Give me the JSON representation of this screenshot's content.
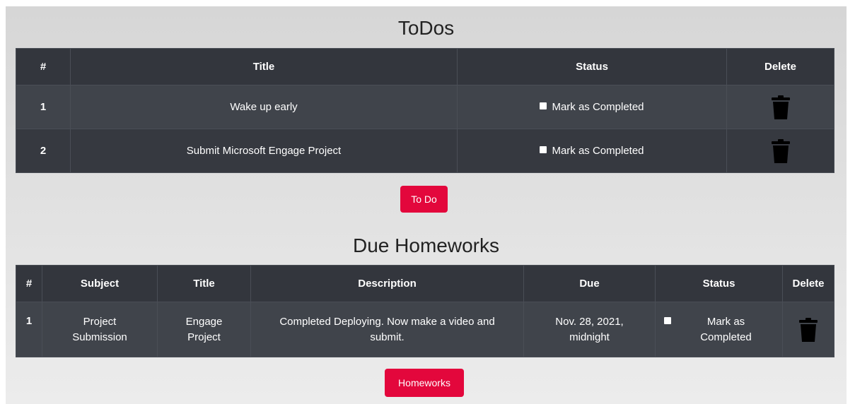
{
  "todos": {
    "heading": "ToDos",
    "columns": [
      "#",
      "Title",
      "Status",
      "Delete"
    ],
    "rows": [
      {
        "num": "1",
        "title": "Wake up early",
        "status": "Mark as Completed"
      },
      {
        "num": "2",
        "title": "Submit Microsoft Engage Project",
        "status": "Mark as Completed"
      }
    ],
    "button_label": "To Do"
  },
  "homeworks": {
    "heading": "Due Homeworks",
    "columns": [
      "#",
      "Subject",
      "Title",
      "Description",
      "Due",
      "Status",
      "Delete"
    ],
    "rows": [
      {
        "num": "1",
        "subject_line1": "Project",
        "subject_line2": "Submission",
        "title_line1": "Engage",
        "title_line2": "Project",
        "description_line1": "Completed Deploying. Now make a video and",
        "description_line2": "submit.",
        "due_line1": "Nov. 28, 2021,",
        "due_line2": "midnight",
        "status_line1": "Mark as",
        "status_line2": "Completed"
      }
    ],
    "button_label": "Homeworks"
  },
  "colors": {
    "table_bg": "#3d4148",
    "header_bg": "#33363d",
    "button_bg": "#e3073c"
  },
  "icons": {
    "delete": "trash-icon",
    "checkbox": "checkbox-icon"
  }
}
